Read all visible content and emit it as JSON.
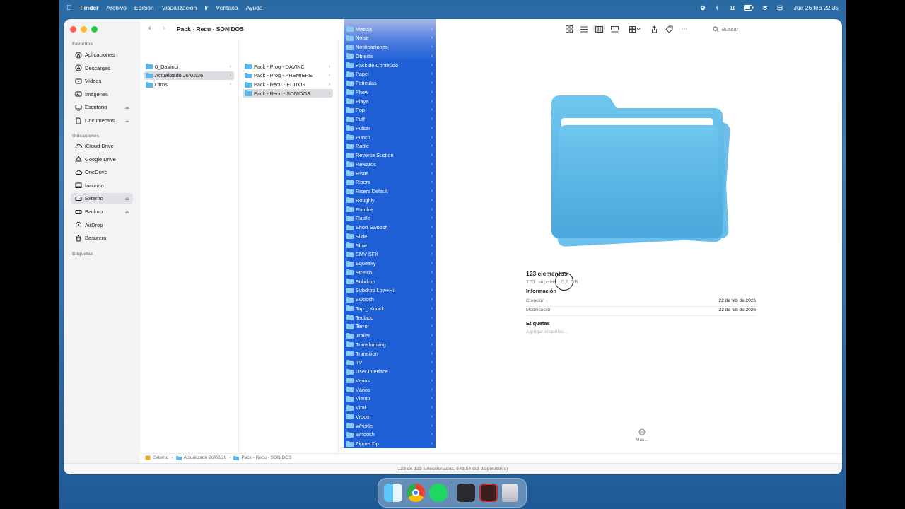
{
  "menubar": {
    "items": [
      "Finder",
      "Archivo",
      "Edición",
      "Visualización",
      "Ir",
      "Ventana",
      "Ayuda"
    ],
    "clock": "Jue 26 feb  22:35"
  },
  "toolbar": {
    "title": "Pack - Recu - SONIDOS",
    "search_placeholder": "Buscar"
  },
  "sidebar": {
    "favorites_label": "Favoritos",
    "favorites": [
      {
        "label": "Aplicaciones",
        "icon": "apps-icon"
      },
      {
        "label": "Descargas",
        "icon": "download-icon"
      },
      {
        "label": "Vídeos",
        "icon": "video-icon"
      },
      {
        "label": "Imágenes",
        "icon": "image-icon"
      },
      {
        "label": "Escritorio",
        "icon": "desktop-icon"
      },
      {
        "label": "Documentos",
        "icon": "document-icon"
      }
    ],
    "locations_label": "Ubicaciones",
    "locations": [
      {
        "label": "iCloud Drive",
        "icon": "cloud-icon"
      },
      {
        "label": "Google Drive",
        "icon": "drive-icon"
      },
      {
        "label": "OneDrive",
        "icon": "cloud-icon"
      },
      {
        "label": "facundo",
        "icon": "computer-icon"
      },
      {
        "label": "Externo",
        "icon": "disk-icon"
      },
      {
        "label": "Backup",
        "icon": "disk-icon"
      },
      {
        "label": "AirDrop",
        "icon": "airdrop-icon"
      },
      {
        "label": "Basurero",
        "icon": "trash-icon"
      }
    ],
    "tags_label": "Etiquetas"
  },
  "columns": {
    "col1": [
      "0_DaVinci",
      "Actualizado 26/02/26",
      "Otros"
    ],
    "col1_selected": 1,
    "col2": [
      "Pack - Prog - DAVINCI",
      "Pack - Prog - PREMIERE",
      "Pack - Recu - EDITOR",
      "Pack - Recu - SONIDOS"
    ],
    "col2_selected": 3,
    "col3": [
      "Mezcla",
      "Noise",
      "Notificaciones",
      "Objects",
      "Pack de Conteúdo",
      "Papel",
      "Películas",
      "Phew",
      "Playa",
      "Pop",
      "Puff",
      "Pulsar",
      "Punch",
      "Rattle",
      "Reverse Suction",
      "Rewards",
      "Risas",
      "Risers",
      "Risers Default",
      "Roughly",
      "Rumble",
      "Rustle",
      "Short Swoosh",
      "Slide",
      "Slow",
      "SMV SFX",
      "Squeaky",
      "Stretch",
      "Subdrop",
      "Subdrop Low+Hi",
      "Swoosh",
      "Tap _ Knock",
      "Teclado",
      "Terror",
      "Trailer",
      "Transforming",
      "Transition",
      "TV",
      "User Interface",
      "Varios",
      "Vários",
      "Viento",
      "Viral",
      "Vroom",
      "Whistle",
      "Whoosh",
      "Zipper Zip"
    ]
  },
  "preview": {
    "title": "123 elementos",
    "subtitle": "123 carpetas - 5,8 GB",
    "info_heading": "Información",
    "info": [
      {
        "label": "Creación",
        "value": "22 de feb de 2026"
      },
      {
        "label": "Modificación",
        "value": "22 de feb de 2026"
      }
    ],
    "tags_heading": "Etiquetas",
    "tags_placeholder": "Agregar etiquetas...",
    "more_label": "Más..."
  },
  "pathbar": [
    "Externo",
    "Actualizado 26/02/26",
    "Pack - Recu - SONIDOS"
  ],
  "status": "123 de 123 seleccionados, 543,54 GB disponible(s)",
  "colors": {
    "accent": "#1f5fd6",
    "folder": "#5ab6e8"
  }
}
